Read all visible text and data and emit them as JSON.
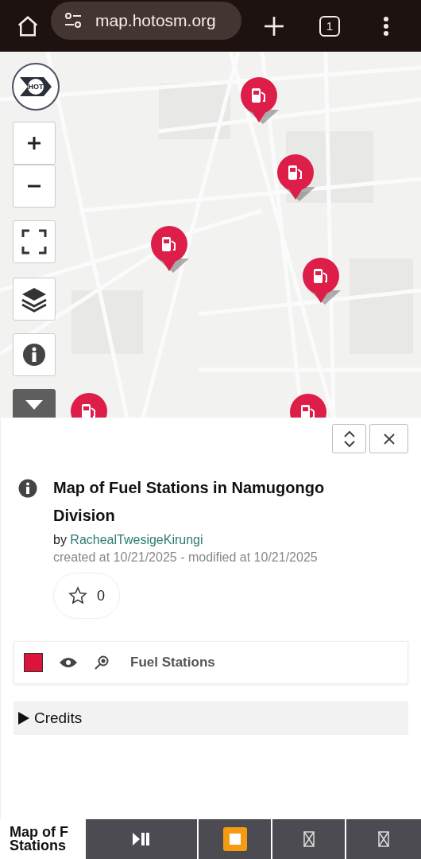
{
  "browser": {
    "url": "map.hotosm.org",
    "tab_count": "1"
  },
  "map": {
    "logo_text": "HOT"
  },
  "panel": {
    "title": "Map of Fuel Stations in Namugongo Division",
    "by": "by",
    "author": "RachealTwesigeKirungi",
    "dates": "created at 10/21/2025 - modified at 10/21/2025",
    "star_count": "0",
    "layers": [
      {
        "name": "Fuel Stations",
        "color": "#dc143c",
        "visible": true
      }
    ],
    "credits": {
      "label": "Credits",
      "expanded": false
    }
  },
  "bottom_bar": {
    "title_lines": [
      "Map of F",
      "Stations"
    ]
  }
}
